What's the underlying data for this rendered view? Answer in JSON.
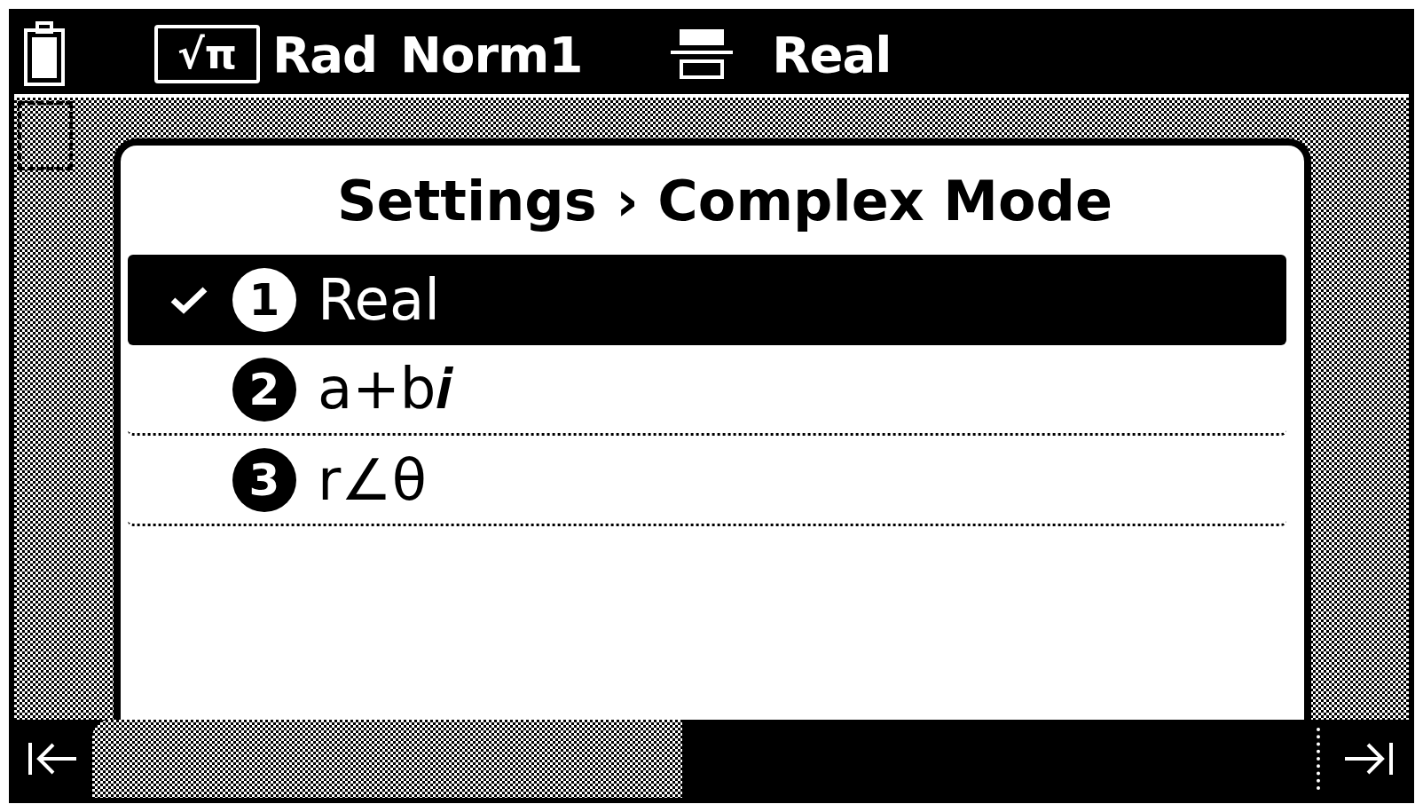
{
  "status_bar": {
    "mode_badge": "√π",
    "angle_unit": "Rad",
    "display_format": "Norm1",
    "complex_mode": "Real"
  },
  "dialog": {
    "title": "Settings › Complex Mode",
    "options": [
      {
        "number": "1",
        "label": "Real",
        "selected": true,
        "checked": true
      },
      {
        "number": "2",
        "label": "a+b𝒊",
        "selected": false,
        "checked": false
      },
      {
        "number": "3",
        "label": "r∠θ",
        "selected": false,
        "checked": false
      }
    ]
  }
}
